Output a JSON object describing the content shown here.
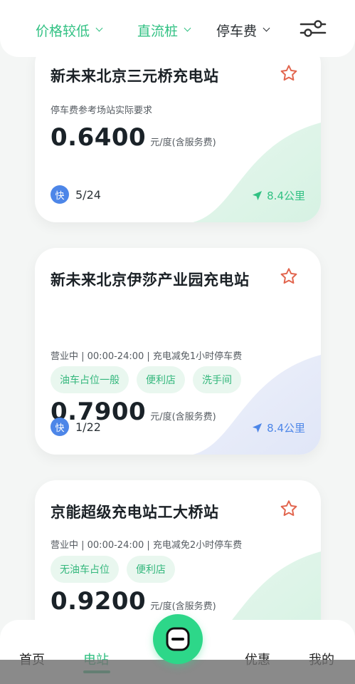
{
  "filters": [
    {
      "label": "价格较低",
      "color": "#31c183"
    },
    {
      "label": "直流桩",
      "color": "#31c183"
    },
    {
      "label": "停车费",
      "color": "#2a2f33"
    }
  ],
  "stations": [
    {
      "name": "新未来北京三元桥充电站",
      "info": "停车费参考场站实际要求",
      "tags": [],
      "price": "0.6400",
      "unit": "元/度(含服务费)",
      "fast_label": "快",
      "fast_count": "5/24",
      "distance": "8.4公里",
      "accent": "#31c183"
    },
    {
      "name": "新未来北京伊莎产业园充电站",
      "info": "营业中 | 00:00-24:00 | 充电减免1小时停车费",
      "tags": [
        "油车占位一般",
        "便利店",
        "洗手间"
      ],
      "price": "0.7900",
      "unit": "元/度(含服务费)",
      "fast_label": "快",
      "fast_count": "1/22",
      "distance": "8.4公里",
      "accent": "#4d86e8"
    },
    {
      "name": "京能超级充电站工大桥站",
      "info": "营业中 | 00:00-24:00 | 充电减免2小时停车费",
      "tags": [
        "无油车占位",
        "便利店"
      ],
      "price": "0.9200",
      "unit": "元/度(含服务费)",
      "fast_label": "",
      "fast_count": "",
      "distance": "",
      "accent": "#31c183"
    }
  ],
  "bottom_nav": [
    {
      "label": "首页",
      "active": false
    },
    {
      "label": "电站",
      "active": true
    },
    {
      "label": "优惠",
      "active": false
    },
    {
      "label": "我的",
      "active": false
    }
  ],
  "colors": {
    "brand_green": "#2fbf80",
    "star": "#e2664f",
    "fast_blue": "#4d86e8"
  }
}
